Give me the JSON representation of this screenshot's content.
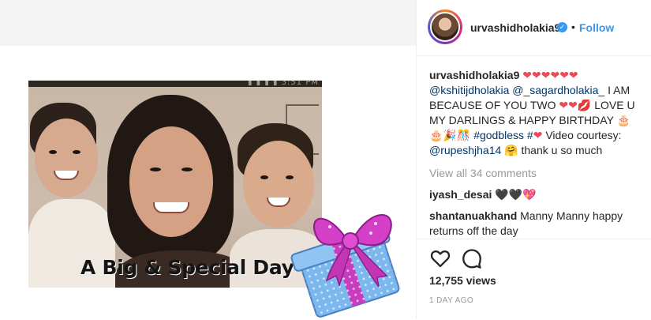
{
  "media": {
    "status_text": "▮ ▮ ▮ ▮ 3:51 PM",
    "caption": "A Big & Special Day"
  },
  "header": {
    "username": "urvashidholakia9",
    "verified_mark": "✓",
    "separator": "•",
    "follow_label": "Follow"
  },
  "caption": {
    "username": "urvashidholakia9",
    "hearts1": "❤❤❤❤❤❤",
    "mention1": "@kshitijdholakia",
    "mention2": "@_sagardholakia_",
    "text1": "I AM BECAUSE OF YOU TWO",
    "hearts2": "❤❤",
    "kiss": "💋",
    "text2": "LOVE U MY DARLINGS & HAPPY BIRTHDAY",
    "cakes": "🎂🎂🎉🎊",
    "hashtag": "#godbless #",
    "hash_heart": "❤",
    "text3": "Video courtesy:",
    "mention3": "@rupeshjha14",
    "hug": "🤗",
    "text4": "thank u so much"
  },
  "view_all": "View all 34 comments",
  "comments": [
    {
      "username": "iyash_desai",
      "text": "🖤🖤💖"
    },
    {
      "username": "shantanuakhand",
      "text": "Manny Manny happy returns off the day"
    }
  ],
  "stats": {
    "views": "12,755 views",
    "time": "1 DAY AGO"
  },
  "colors": {
    "accent": "#3897f0",
    "heart": "#ed4956",
    "muted": "#999999"
  },
  "icons": [
    "heart-icon",
    "comment-icon",
    "verified-icon",
    "gift-icon"
  ]
}
